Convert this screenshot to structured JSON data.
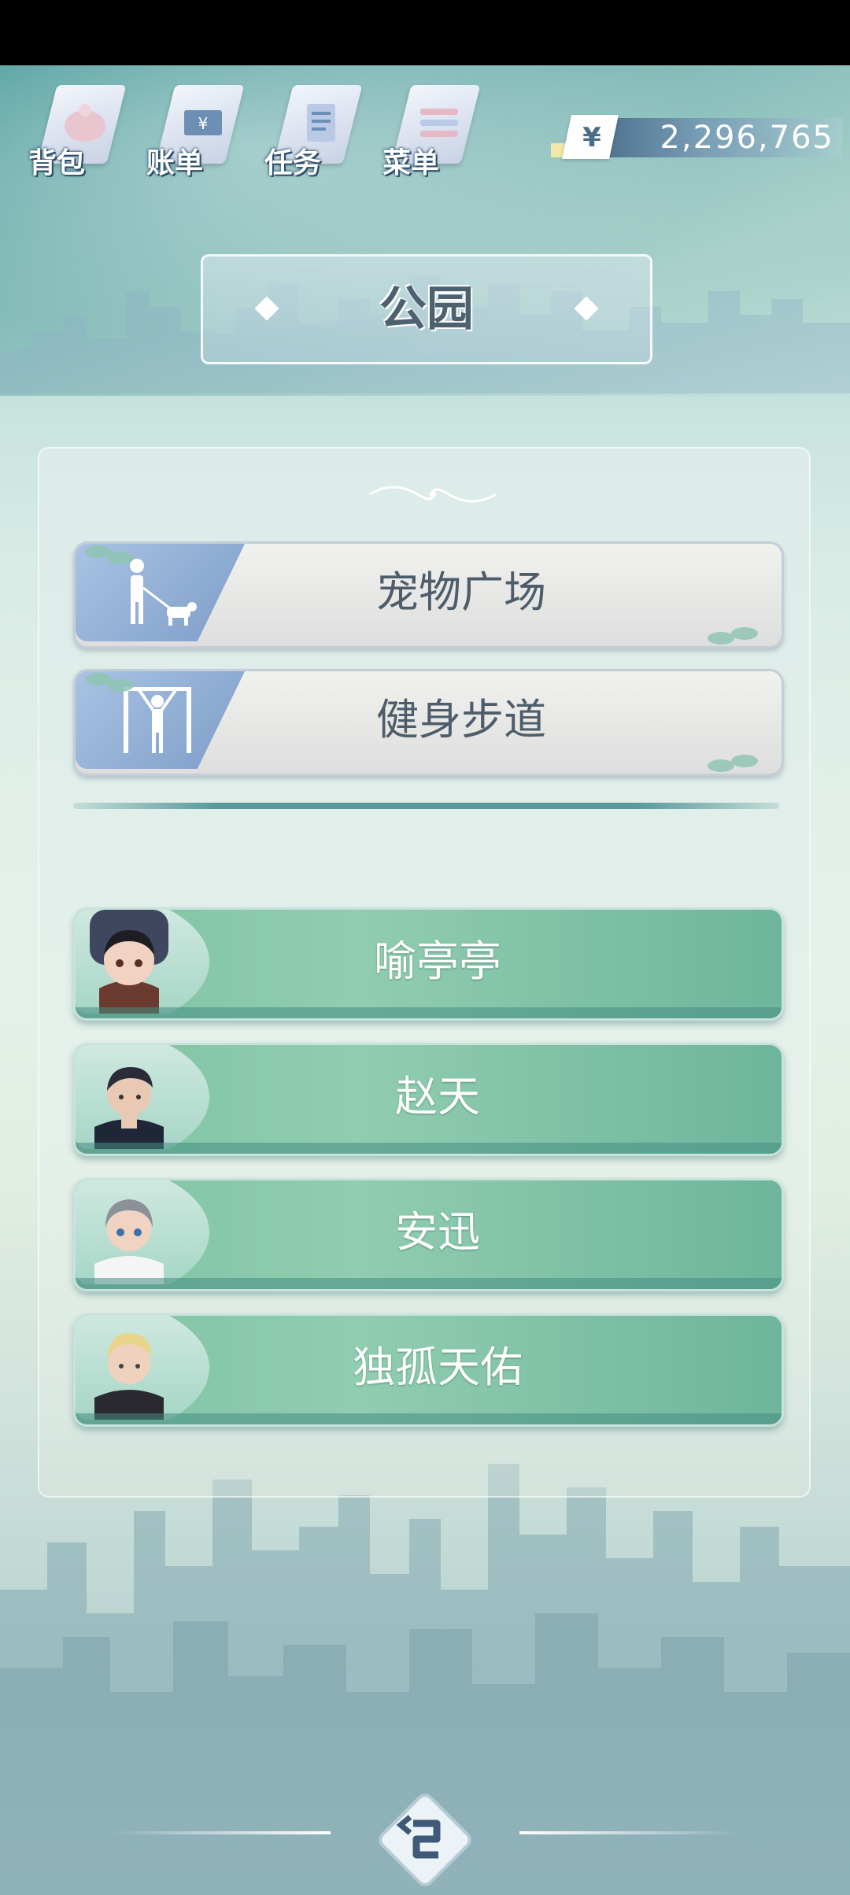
{
  "nav": {
    "items": [
      {
        "label": "背包",
        "icon": "backpack-icon"
      },
      {
        "label": "账单",
        "icon": "bill-icon"
      },
      {
        "label": "任务",
        "icon": "task-icon"
      },
      {
        "label": "菜单",
        "icon": "menu-icon"
      }
    ]
  },
  "money": {
    "symbol": "¥",
    "value": "2,296,765"
  },
  "title": "公园",
  "locations": [
    {
      "label": "宠物广场",
      "icon": "dog-walking-icon"
    },
    {
      "label": "健身步道",
      "icon": "fitness-icon"
    }
  ],
  "npcs": [
    {
      "name": "喻亭亭"
    },
    {
      "name": "赵天"
    },
    {
      "name": "安迅"
    },
    {
      "name": "独孤天佑"
    }
  ],
  "colors": {
    "accent": "#5a9a9c",
    "npc_button": "#7fc3a4",
    "title_text": "#4d6170"
  }
}
